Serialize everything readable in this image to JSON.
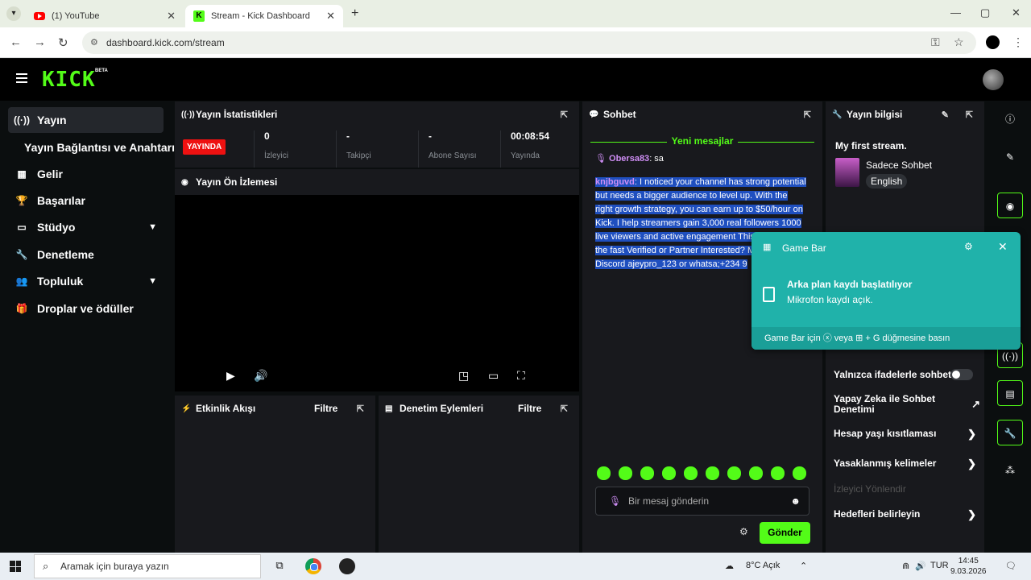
{
  "browser": {
    "tabs": [
      {
        "title": "(1) YouTube"
      },
      {
        "title": "Stream - Kick Dashboard"
      }
    ],
    "url": "dashboard.kick.com/stream"
  },
  "kick": {
    "logo": "KICK",
    "beta": "BETA",
    "sidebar": {
      "items": [
        {
          "label": "Yayın",
          "icon": "broadcast-icon"
        },
        {
          "label": "Yayın Bağlantısı ve Anahtarı"
        },
        {
          "label": "Gelir",
          "icon": "chart-icon"
        },
        {
          "label": "Başarılar",
          "icon": "trophy-icon"
        },
        {
          "label": "Stüdyo",
          "icon": "studio-icon"
        },
        {
          "label": "Denetleme",
          "icon": "wrench-icon"
        },
        {
          "label": "Topluluk",
          "icon": "people-icon"
        },
        {
          "label": "Droplar ve ödüller",
          "icon": "gift-icon"
        }
      ]
    },
    "stats": {
      "title": "Yayın İstatistikleri",
      "live_badge": "YAYINDA",
      "items": [
        {
          "value": "0",
          "label": "İzleyici"
        },
        {
          "value": "-",
          "label": "Takipçi"
        },
        {
          "value": "-",
          "label": "Abone Sayısı"
        },
        {
          "value": "00:08:54",
          "label": "Yayında"
        }
      ]
    },
    "preview": {
      "title": "Yayın Ön İzlemesi"
    },
    "activity": {
      "title": "Etkinlik Akışı",
      "filter": "Filtre"
    },
    "modlog": {
      "title": "Denetim Eylemleri",
      "filter": "Filtre"
    },
    "chat": {
      "title": "Sohbet",
      "new_messages": "Yeni mesajlar",
      "msg1_user": "Obersa83",
      "msg1_text": ": sa",
      "msg2_user": "knjbguvd",
      "msg2_text": ": I noticed your channel has strong potential but needs a bigger audience to level up. With the right growth strategy, you can earn up to $50/hour on Kick. I help streamers gain 3,000 real followers 1000 live viewers and active engagement This puts you on the fast Verified or Partner Interested? Messag Discord ajeypro_123 or whatsa;+234 9",
      "input_placeholder": "Bir mesaj gönderin",
      "send_label": "Gönder"
    },
    "info": {
      "title": "Yayın bilgisi",
      "stream_title": "My first stream.",
      "category": "Sadece Sohbet",
      "language": "English",
      "settings": [
        {
          "label": "Yalnızca ifadelerle sohbet"
        },
        {
          "label": "Yapay Zeka ile Sohbet Denetimi"
        },
        {
          "label": "Hesap yaşı kısıtlaması"
        },
        {
          "label": "Yasaklanmış kelimeler"
        },
        {
          "label": "İzleyici Yönlendir"
        },
        {
          "label": "Hedefleri belirleyin"
        }
      ]
    }
  },
  "gamebar": {
    "app": "Game Bar",
    "title": "Arka plan kaydı başlatılıyor",
    "body": "Mikrofon kaydı açık.",
    "footer": "Game Bar için ⓧ veya ⊞ + G düğmesine basın"
  },
  "taskbar": {
    "search_placeholder": "Aramak için buraya yazın",
    "weather": "8°C  Açık",
    "lang": "TUR",
    "time": "14:45",
    "date": "9.03.2026"
  },
  "colors": {
    "kick_green": "#53fc18",
    "live_red": "#e11111",
    "gamebar_teal": "#20b2aa"
  }
}
